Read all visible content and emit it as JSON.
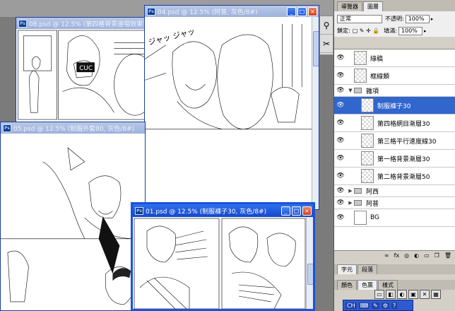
{
  "windows": {
    "w08": {
      "title": "08.psd @ 12.5% (第四格背景遠噁效果筆刷, 灰色/8#)"
    },
    "w04": {
      "title": "04.psd @ 12.5% (阿普, 灰色/8#)",
      "sfx": "ジャッ ジャッ"
    },
    "w05": {
      "title": "05.psd @ 12.5% (制服外套80, 灰色/8#)"
    },
    "w01": {
      "title": "01.psd @ 12.5% (制服褲子30, 灰色/8#)"
    }
  },
  "panel": {
    "tabs": [
      "導覽器",
      "圖層"
    ],
    "blend_mode": "正常",
    "opacity_label": "不透明:",
    "opacity_value": "100%",
    "lock_label": "鎖定:",
    "fill_label": "填滿:",
    "fill_value": "100%",
    "layers": [
      {
        "name": "綠稿",
        "kind": "layer",
        "visible": true
      },
      {
        "name": "框線類",
        "kind": "layer",
        "visible": true
      },
      {
        "name": "雜項",
        "kind": "group-open",
        "visible": true
      },
      {
        "name": "制服褲子30",
        "kind": "layer",
        "visible": true,
        "selected": true,
        "indent": true
      },
      {
        "name": "第四格網目漸層30",
        "kind": "layer",
        "visible": true,
        "indent": true
      },
      {
        "name": "第三格平行速度線30",
        "kind": "layer",
        "visible": true,
        "indent": true
      },
      {
        "name": "第一格背景漸層30",
        "kind": "layer",
        "visible": true,
        "indent": true
      },
      {
        "name": "第二格背景漸層50",
        "kind": "layer",
        "visible": true,
        "indent": true
      },
      {
        "name": "阿西",
        "kind": "group",
        "visible": true
      },
      {
        "name": "阿普",
        "kind": "group",
        "visible": true
      },
      {
        "name": "BG",
        "kind": "bg",
        "visible": true
      }
    ],
    "footer_icons": [
      "fx",
      "◎",
      "◐",
      "▭",
      "❐",
      "🗑"
    ],
    "lower_tabs_1": [
      "字元",
      "段落"
    ],
    "lower_tabs_2": [
      "顏色",
      "色票",
      "樣式"
    ]
  },
  "taskbar": {
    "lang": "CH"
  }
}
